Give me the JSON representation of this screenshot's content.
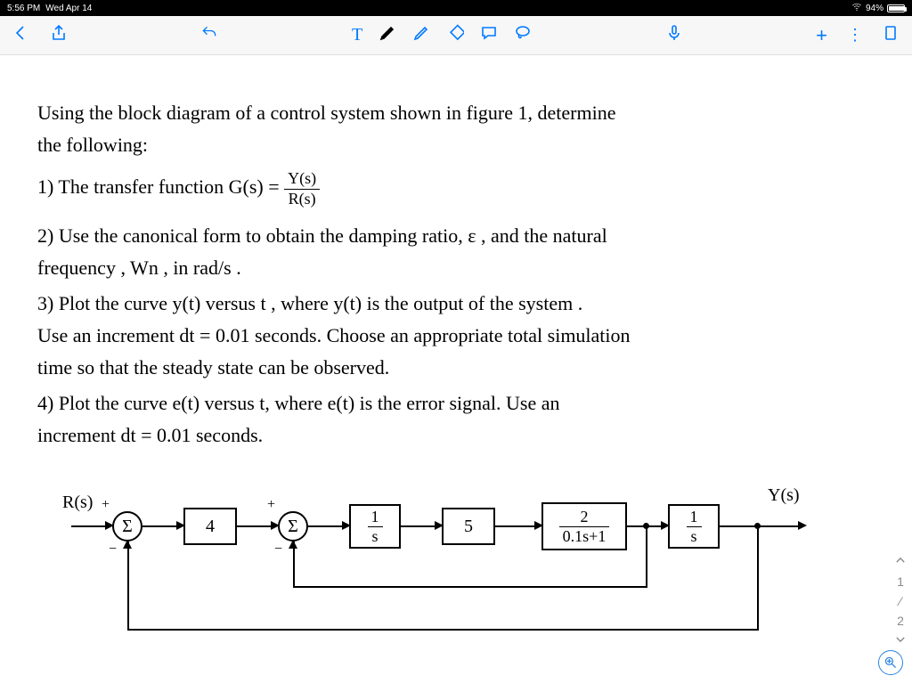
{
  "status": {
    "time": "5:56 PM",
    "date": "Wed Apr 14",
    "wifi": "wifi-icon",
    "battery_pct": "94%",
    "battery_level": 94
  },
  "toolbar": {
    "left": {
      "back": "back-chevron",
      "share": "share-icon"
    },
    "undo": "undo-icon",
    "center": {
      "text_tool": "T",
      "pen": "pen-icon",
      "pencil": "pencil-icon",
      "eraser": "diamond-icon",
      "chat": "speech-icon",
      "paw": "paw-icon"
    },
    "mic": "mic-icon",
    "right": {
      "plus": "+",
      "more": "⋮",
      "pages": "page-icon"
    }
  },
  "handwriting": {
    "l1": "Using the block diagram of a control system shown in figure 1, determine",
    "l2": "the following:",
    "l3a": "1) The transfer function  G(s) = ",
    "l3_num": "Y(s)",
    "l3_den": "R(s)",
    "l4": "2) Use the canonical form to obtain the damping ratio, ε , and the natural",
    "l5": "   frequency , Wn , in rad/s .",
    "l6": "3) Plot the curve y(t) versus t , where y(t) is the output of the system .",
    "l7": "   Use an increment dt = 0.01 seconds. Choose an appropriate total simulation",
    "l8": "   time so that the steady state can be observed.",
    "l9": "4) Plot the curve  e(t) versus t, where e(t) is the error signal. Use an",
    "l10": "   increment dt = 0.01 seconds."
  },
  "diagram": {
    "input": "R(s)",
    "output": "Y(s)",
    "sum": "Σ",
    "block_gain1": "4",
    "block_int1_num": "1",
    "block_int1_den": "s",
    "block_gain2": "5",
    "block_tf_num": "2",
    "block_tf_den": "0.1s+1",
    "block_int2_num": "1",
    "block_int2_den": "s",
    "signs": {
      "plus": "+",
      "minus": "−"
    }
  },
  "edge": {
    "up": "˄",
    "page_curr": "1",
    "page_sep": "⁄",
    "page_total": "2",
    "down": "˅",
    "zoom": "⊕"
  }
}
